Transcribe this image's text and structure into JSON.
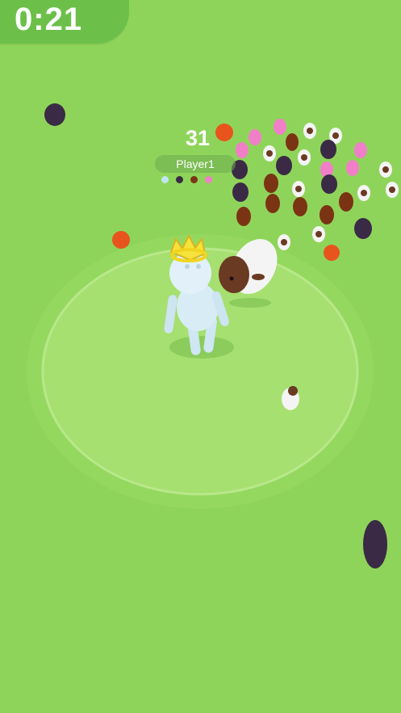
{
  "hud": {
    "timer": "0:21",
    "score": "31",
    "player_name": "Player1",
    "herd_colors": [
      "#bfe6f0",
      "#3a2a45",
      "#7a3414",
      "#f07fc8"
    ]
  },
  "colors": {
    "ground": "#8fd45a",
    "timer_panel": "#6cc04a",
    "ring": "#a8df6e",
    "player": "#d8ecf6",
    "crown": "#f6e23a"
  },
  "animals": {
    "pig": "#f07fc8",
    "sheep": "#f4f4f4",
    "bull": "#3a2a45",
    "horse": "#7a3414",
    "rooster": "#e8541e"
  }
}
